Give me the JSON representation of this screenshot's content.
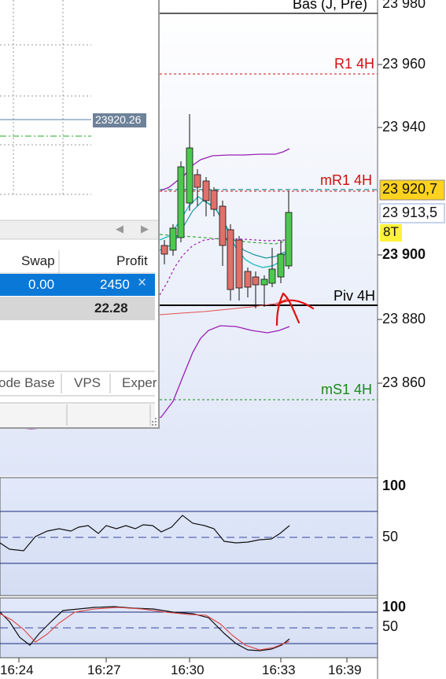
{
  "price_axis": {
    "labels": [
      "23 980",
      "23 960",
      "23 940",
      "23 920,7",
      "23 913,5",
      "8T",
      "23 900",
      "23 880",
      "23 860"
    ]
  },
  "levels": {
    "bas": "Bas (J, Pré)",
    "r1_4h": "R1 4H",
    "mr1_4h": "mR1 4H",
    "piv_4h": "Piv 4H",
    "ms1_4h": "mS1 4H"
  },
  "indicator1": {
    "labels": [
      "100",
      "50"
    ]
  },
  "indicator2": {
    "labels": [
      "100",
      "50"
    ]
  },
  "time_axis": {
    "labels": [
      "16:24",
      "16:27",
      "16:30",
      "16:33",
      "16:39"
    ]
  },
  "panel": {
    "price_tag": "23920.26",
    "nav_left": "◀",
    "nav_right": "▶",
    "columns": {
      "swap": "Swap",
      "profit": "Profit"
    },
    "selected_row": {
      "swap": "0.00",
      "profit": "2450",
      "close": "×"
    },
    "total_row": {
      "profit": "22.28"
    },
    "tabs": [
      "ode Base",
      "VPS",
      "Exper"
    ]
  },
  "colors": {
    "bull_candle": "#4cc94c",
    "bear_candle": "#e0706a",
    "resistance": "#d01010",
    "support": "#1a8a1a",
    "current_price_bg": "#ffd21f",
    "selected_row_bg": "#0a78d7"
  }
}
